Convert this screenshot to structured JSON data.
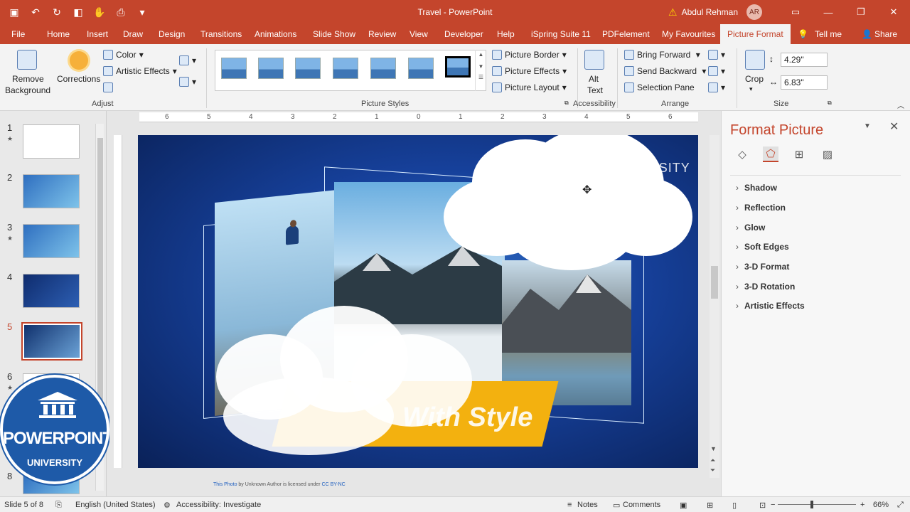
{
  "window": {
    "title": "Travel  -  PowerPoint",
    "user_name": "Abdul Rehman",
    "user_initials": "AR"
  },
  "tabs": [
    {
      "label": "File"
    },
    {
      "label": "Home"
    },
    {
      "label": "Insert"
    },
    {
      "label": "Draw"
    },
    {
      "label": "Design"
    },
    {
      "label": "Transitions"
    },
    {
      "label": "Animations"
    },
    {
      "label": "Slide Show"
    },
    {
      "label": "Review"
    },
    {
      "label": "View"
    },
    {
      "label": "Developer"
    },
    {
      "label": "Help"
    },
    {
      "label": "iSpring Suite 11"
    },
    {
      "label": "PDFelement"
    },
    {
      "label": "My Favourites"
    },
    {
      "label": "Picture Format"
    },
    {
      "label": "Tell me"
    },
    {
      "label": "Share"
    }
  ],
  "ribbon": {
    "remove_bg_1": "Remove",
    "remove_bg_2": "Background",
    "corrections": "Corrections",
    "color": "Color",
    "artistic_effects": "Artistic Effects",
    "adjust": "Adjust",
    "picture_styles": "Picture Styles",
    "picture_border": "Picture Border",
    "picture_effects": "Picture Effects",
    "picture_layout": "Picture Layout",
    "alt_1": "Alt",
    "alt_2": "Text",
    "accessibility": "Accessibility",
    "bring_forward": "Bring Forward",
    "send_backward": "Send Backward",
    "selection_pane": "Selection Pane",
    "arrange": "Arrange",
    "crop": "Crop",
    "height": "4.29\"",
    "width": "6.83\"",
    "size": "Size"
  },
  "ruler_ticks": [
    "6",
    "5",
    "4",
    "3",
    "2",
    "1",
    "0",
    "1",
    "2",
    "3",
    "4",
    "5",
    "6"
  ],
  "slides": [
    {
      "num": "1",
      "star": "★"
    },
    {
      "num": "2",
      "star": ""
    },
    {
      "num": "3",
      "star": "★"
    },
    {
      "num": "4",
      "star": ""
    },
    {
      "num": "5",
      "star": ""
    },
    {
      "num": "6",
      "star": "★"
    },
    {
      "num": "8",
      "star": ""
    }
  ],
  "badge": {
    "line1": "POWERPOINT",
    "line2": "UNIVERSITY"
  },
  "slide_content": {
    "heading": "POWERPOINT UNIVERSITY",
    "title": "With Style",
    "credit_link": "This Photo",
    "credit_text": " by Unknown Author is licensed under ",
    "credit_license": "CC BY-NC"
  },
  "format_pane": {
    "title": "Format Picture",
    "sections": [
      "Shadow",
      "Reflection",
      "Glow",
      "Soft Edges",
      "3-D Format",
      "3-D Rotation",
      "Artistic Effects"
    ]
  },
  "status": {
    "slide_of": "Slide 5 of 8",
    "language": "English (United States)",
    "accessibility": "Accessibility: Investigate",
    "notes": "Notes",
    "comments": "Comments",
    "zoom": "66%"
  },
  "colors": {
    "accent": "#c4452c",
    "slide_blue": "#16409a",
    "ribbon_yellow": "#f3b10f"
  }
}
